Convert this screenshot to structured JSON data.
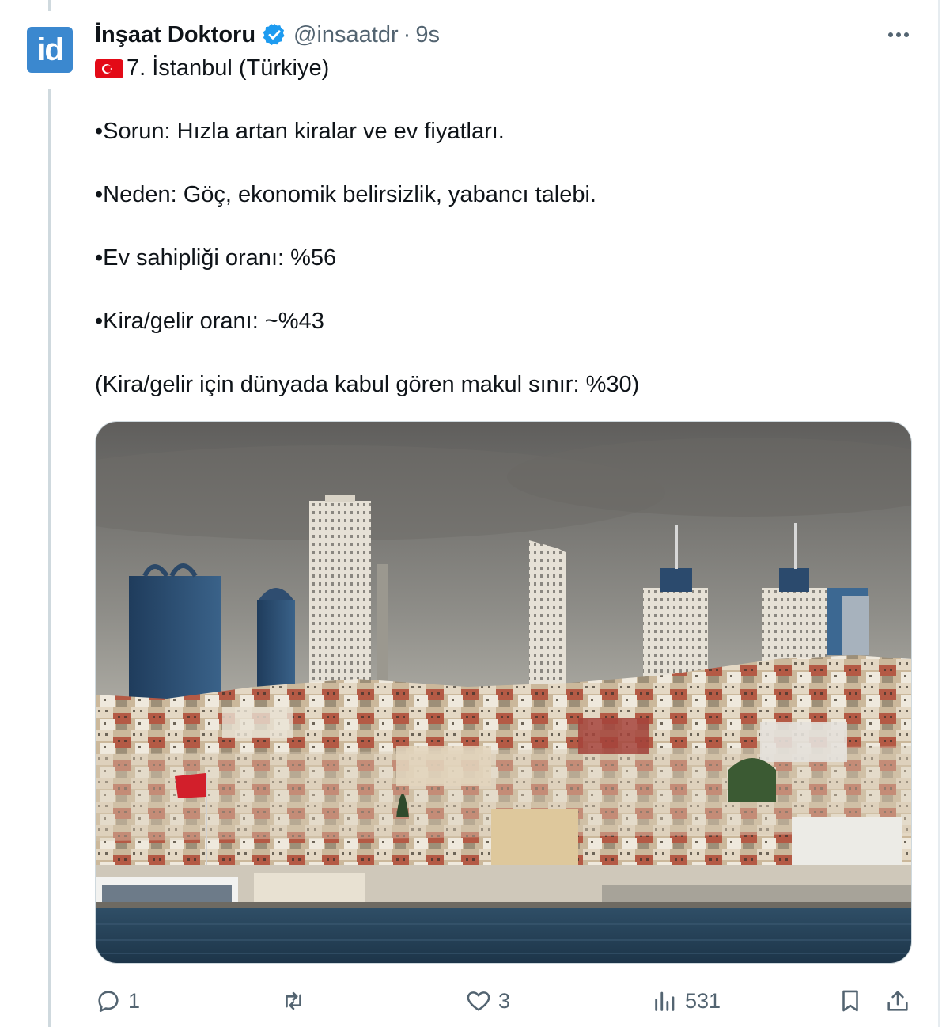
{
  "tweet": {
    "avatar_text": "id",
    "display_name": "İnşaat Doktoru",
    "handle": "@insaatdr",
    "separator": "·",
    "time": "9s",
    "title_line": "7. İstanbul (Türkiye)",
    "lines": [
      "•Sorun: Hızla artan kiralar ve ev fiyatları.",
      "•Neden: Göç, ekonomik belirsizlik, yabancı talebi.",
      "•Ev sahipliği oranı: %56",
      "•Kira/gelir oranı: ~%43",
      "(Kira/gelir için dünyada kabul gören makul sınır: %30)"
    ],
    "actions": {
      "replies": "1",
      "retweets": "",
      "likes": "3",
      "views": "531"
    }
  },
  "colors": {
    "accent": "#1d9bf0",
    "muted": "#536471",
    "text": "#0f1419",
    "avatar_bg": "#3b88cf",
    "flag_red": "#e30a17"
  },
  "icons": [
    "verified-badge-icon",
    "more-icon",
    "reply-icon",
    "retweet-icon",
    "like-icon",
    "views-icon",
    "bookmark-icon",
    "share-icon"
  ]
}
